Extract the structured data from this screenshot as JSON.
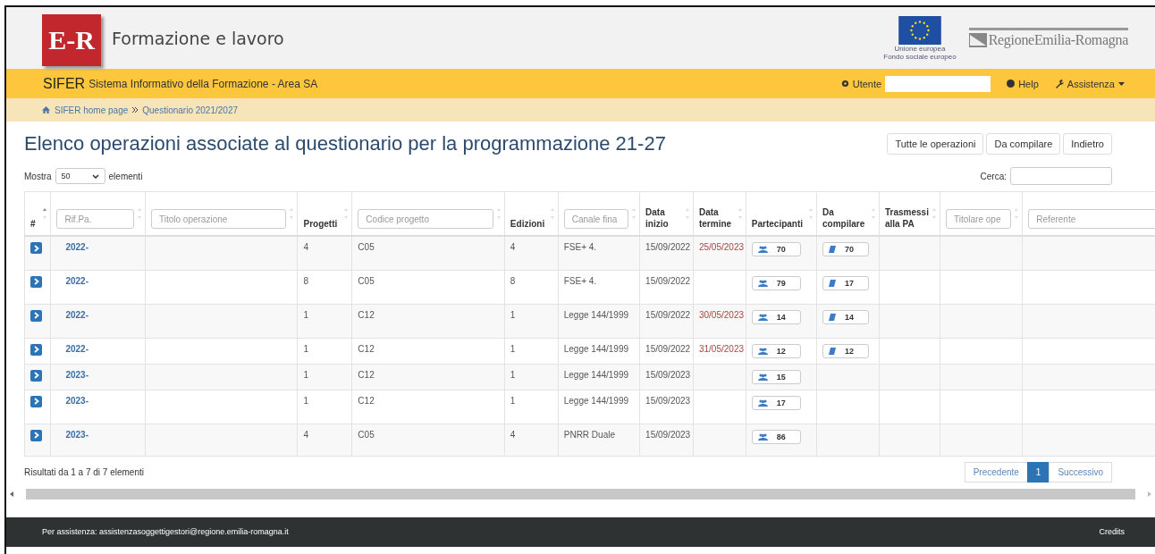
{
  "header": {
    "logo_text": "E-R",
    "title": "Formazione e lavoro",
    "eu_caption": [
      "Unione europea",
      "Fondo sociale europeo"
    ],
    "region": "RegioneEmilia-Romagna"
  },
  "navbar": {
    "brand": "SIFER",
    "subtitle": "Sistema Informativo della Formazione - Area SA",
    "user_label": "Utente",
    "help": "Help",
    "assistance": "Assistenza"
  },
  "breadcrumb": [
    "SIFER home page",
    "Questionario 2021/2027"
  ],
  "page_title": "Elenco operazioni associate al questionario per la programmazione 21-27",
  "buttons": [
    "Tutte le operazioni",
    "Da compilare",
    "Indietro"
  ],
  "length": {
    "before": "Mostra",
    "value": "50",
    "after": "elementi"
  },
  "search": {
    "label": "Cerca:"
  },
  "table": {
    "columns": [
      {
        "kind": "plain",
        "label": "#"
      },
      {
        "kind": "filter",
        "placeholder": "Rif.Pa."
      },
      {
        "kind": "filter",
        "placeholder": "Titolo operazione"
      },
      {
        "kind": "plain",
        "label": "Progetti"
      },
      {
        "kind": "filter",
        "placeholder": "Codice progetto"
      },
      {
        "kind": "plain",
        "label": "Edizioni"
      },
      {
        "kind": "filter",
        "placeholder": "Canale fina"
      },
      {
        "kind": "plain",
        "label": "Data inizio"
      },
      {
        "kind": "plain",
        "label": "Data termine"
      },
      {
        "kind": "plain",
        "label": "Partecipanti"
      },
      {
        "kind": "plain",
        "label": "Da compilare"
      },
      {
        "kind": "plain",
        "label": "Trasmessi alla PA"
      },
      {
        "kind": "filter",
        "placeholder": "Titolare ope"
      },
      {
        "kind": "filter",
        "placeholder": "Referente"
      }
    ],
    "rows": [
      {
        "rif": "2022-",
        "progetti": "4",
        "codice": "C05",
        "edizioni": "4",
        "canale": "FSE+ 4.",
        "inizio": "15/09/2022",
        "termine": "25/05/2023",
        "partecipanti": "70",
        "da_compilare": "70"
      },
      {
        "rif": "2022-",
        "progetti": "8",
        "codice": "C05",
        "edizioni": "8",
        "canale": "FSE+ 4.",
        "inizio": "15/09/2022",
        "partecipanti": "79",
        "da_compilare": "17"
      },
      {
        "rif": "2022-",
        "progetti": "1",
        "codice": "C12",
        "edizioni": "1",
        "canale": "Legge 144/1999",
        "inizio": "15/09/2022",
        "termine": "30/05/2023",
        "partecipanti": "14",
        "da_compilare": "14"
      },
      {
        "rif": "2022-",
        "progetti": "1",
        "codice": "C12",
        "edizioni": "1",
        "canale": "Legge 144/1999",
        "inizio": "15/09/2022",
        "termine": "31/05/2023",
        "partecipanti": "12",
        "da_compilare": "12"
      },
      {
        "rif": "2023-",
        "progetti": "1",
        "codice": "C12",
        "edizioni": "1",
        "canale": "Legge 144/1999",
        "inizio": "15/09/2023",
        "partecipanti": "15"
      },
      {
        "rif": "2023-",
        "progetti": "1",
        "codice": "C12",
        "edizioni": "1",
        "canale": "Legge 144/1999",
        "inizio": "15/09/2023",
        "partecipanti": "17"
      },
      {
        "rif": "2023-",
        "progetti": "4",
        "codice": "C05",
        "edizioni": "4",
        "canale": "PNRR Duale",
        "inizio": "15/09/2023",
        "partecipanti": "86"
      }
    ]
  },
  "info": "Risultati da 1 a 7 di 7 elementi",
  "pagination": [
    {
      "label": "Precedente",
      "selected": false
    },
    {
      "label": "1",
      "selected": true
    },
    {
      "label": "Successivo",
      "selected": false
    }
  ],
  "footer": {
    "contact": "Per assistenza: assistenzasoggettigestori@regione.emilia-romagna.it",
    "credits": "Credits"
  }
}
